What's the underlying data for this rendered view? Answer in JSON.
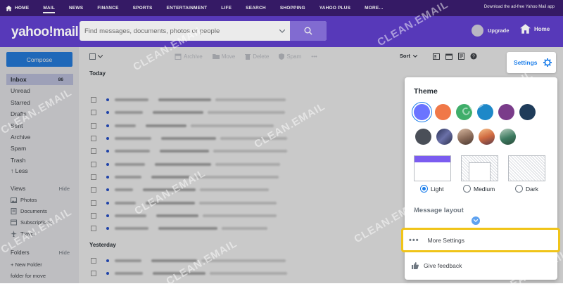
{
  "topnav": {
    "items": [
      {
        "label": "HOME"
      },
      {
        "label": "MAIL"
      },
      {
        "label": "NEWS"
      },
      {
        "label": "FINANCE"
      },
      {
        "label": "SPORTS"
      },
      {
        "label": "ENTERTAINMENT"
      },
      {
        "label": "LIFE"
      },
      {
        "label": "SEARCH"
      },
      {
        "label": "SHOPPING"
      },
      {
        "label": "YAHOO PLUS"
      },
      {
        "label": "MORE..."
      }
    ],
    "adfree": "Download the ad-free Yahoo Mail app"
  },
  "header": {
    "logo": "yahoo!mail",
    "search_placeholder": "Find messages, documents, photos or people",
    "upgrade": "Upgrade",
    "home": "Home"
  },
  "sidebar": {
    "compose": "Compose",
    "folders": [
      {
        "label": "Inbox",
        "count": "86"
      },
      {
        "label": "Unread"
      },
      {
        "label": "Starred"
      },
      {
        "label": "Drafts"
      },
      {
        "label": "Sent"
      },
      {
        "label": "Archive"
      },
      {
        "label": "Spam"
      },
      {
        "label": "Trash"
      },
      {
        "label": "↑ Less"
      }
    ],
    "views_label": "Views",
    "views_hide": "Hide",
    "views": [
      {
        "label": "Photos"
      },
      {
        "label": "Documents"
      },
      {
        "label": "Subscriptions"
      },
      {
        "label": "Travel"
      }
    ],
    "folders_label": "Folders",
    "folders_hide": "Hide",
    "new_folder": "+ New Folder",
    "folder_for_move": "folder for move"
  },
  "toolbar": {
    "archive": "Archive",
    "move": "Move",
    "delete": "Delete",
    "spam": "Spam",
    "more": "•••",
    "sort": "Sort"
  },
  "maillist": {
    "today": "Today",
    "yesterday": "Yesterday"
  },
  "settings": {
    "button": "Settings",
    "theme_title": "Theme",
    "swatch_colors": [
      "#6b74ff",
      "#f07848",
      "#3fae6a",
      "#1e88c8",
      "#7a3c8a",
      "#1f3c5a",
      "#4a4f58"
    ],
    "layout_options": [
      {
        "label": "Light"
      },
      {
        "label": "Medium"
      },
      {
        "label": "Dark"
      }
    ],
    "message_layout": "Message layout",
    "more_settings": "More Settings",
    "give_feedback": "Give feedback"
  },
  "watermark": "CLEAN.EMAIL"
}
